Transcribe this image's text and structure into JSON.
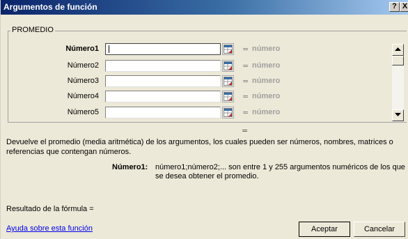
{
  "window": {
    "title": "Argumentos de función",
    "help_button": "?",
    "close_button": "X"
  },
  "function_group": {
    "name": "PROMEDIO",
    "arguments": [
      {
        "label": "Número1",
        "value": "",
        "equals": "=",
        "result": "número",
        "bold": true
      },
      {
        "label": "Número2",
        "value": "",
        "equals": "=",
        "result": "número",
        "bold": false
      },
      {
        "label": "Número3",
        "value": "",
        "equals": "=",
        "result": "número",
        "bold": false
      },
      {
        "label": "Número4",
        "value": "",
        "equals": "=",
        "result": "número",
        "bold": false
      },
      {
        "label": "Número5",
        "value": "",
        "equals": "=",
        "result": "número",
        "bold": false
      }
    ],
    "total_equals": "="
  },
  "description": "Devuelve el promedio (media aritmética) de los argumentos, los cuales pueden ser números, nombres, matrices o referencias que contengan números.",
  "argument_help": {
    "name": "Número1:",
    "text": "número1;número2;... son entre 1 y 255 argumentos numéricos de los que se desea obtener el promedio."
  },
  "formula_result_label": "Resultado de la fórmula =",
  "help_link": "Ayuda sobre esta función",
  "buttons": {
    "ok": "Aceptar",
    "cancel": "Cancelar"
  },
  "colors": {
    "titlebar_start": "#0a246a",
    "dialog_bg": "#ece9d8",
    "link": "#0000ee"
  }
}
